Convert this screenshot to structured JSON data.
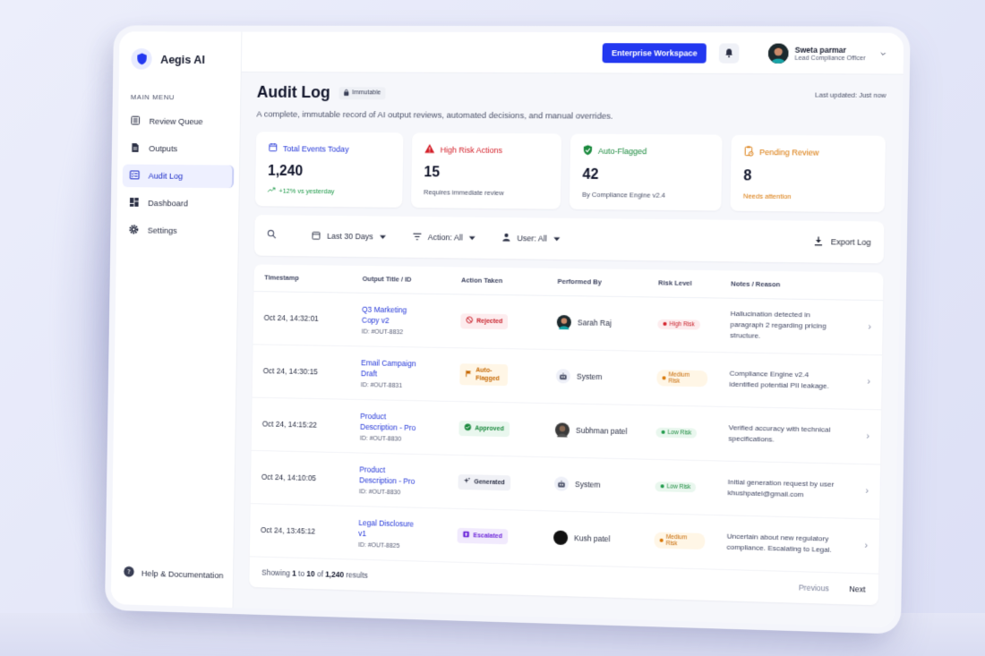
{
  "brand": {
    "name": "Aegis AI"
  },
  "sidebar": {
    "menu_title": "MAIN MENU",
    "items": [
      {
        "label": "Review Queue",
        "icon": "list-icon"
      },
      {
        "label": "Outputs",
        "icon": "document-icon"
      },
      {
        "label": "Audit Log",
        "icon": "checklist-icon",
        "active": true
      },
      {
        "label": "Dashboard",
        "icon": "grid-icon"
      },
      {
        "label": "Settings",
        "icon": "gear-icon"
      }
    ],
    "help_label": "Help & Documentation"
  },
  "topbar": {
    "workspace_button": "Enterprise Workspace",
    "user_name": "Sweta parmar",
    "user_role": "Lead Compliance Officer"
  },
  "header": {
    "title": "Audit Log",
    "badge": "Immutable",
    "last_updated": "Last updated: Just now",
    "subtitle": "A complete, immutable record of AI output reviews, automated decisions, and manual overrides."
  },
  "stats": [
    {
      "label": "Total Events Today",
      "value": "1,240",
      "sub": "+12% vs yesterday",
      "color": "#2336d8",
      "sub_color": "#1f9a4a"
    },
    {
      "label": "High Risk Actions",
      "value": "15",
      "sub": "Requires immediate review",
      "color": "#d4202a",
      "sub_color": "#4a5068"
    },
    {
      "label": "Auto-Flagged",
      "value": "42",
      "sub": "By Compliance Engine v2.4",
      "color": "#1b8a3e",
      "sub_color": "#4a5068"
    },
    {
      "label": "Pending Review",
      "value": "8",
      "sub": "Needs attention",
      "color": "#d97706",
      "sub_color": "#d97706"
    }
  ],
  "filters": {
    "date": "Last 30 Days",
    "action": "Action: All",
    "user": "User: All",
    "export": "Export Log"
  },
  "table": {
    "headers": [
      "Timestamp",
      "Output Title / ID",
      "Action Taken",
      "Performed By",
      "Risk Level",
      "Notes / Reason"
    ],
    "rows": [
      {
        "timestamp": "Oct 24, 14:32:01",
        "title": "Q3 Marketing Copy v2",
        "id": "ID: #OUT-8832",
        "action": "Rejected",
        "by": "Sarah Raj",
        "risk": "High Risk",
        "notes": "Hallucination detected in paragraph 2 regarding pricing structure."
      },
      {
        "timestamp": "Oct 24, 14:30:15",
        "title": "Email Campaign Draft",
        "id": "ID: #OUT-8831",
        "action": "Auto-Flagged",
        "by": "System",
        "risk": "Medium Risk",
        "notes": "Compliance Engine v2.4 identified potential PII leakage."
      },
      {
        "timestamp": "Oct 24, 14:15:22",
        "title": "Product Description - Pro",
        "id": "ID: #OUT-8830",
        "action": "Approved",
        "by": "Subhman patel",
        "risk": "Low Risk",
        "notes": "Verified accuracy with technical specifications."
      },
      {
        "timestamp": "Oct 24, 14:10:05",
        "title": "Product Description - Pro",
        "id": "ID: #OUT-8830",
        "action": "Generated",
        "by": "System",
        "risk": "Low Risk",
        "notes": "Initial generation request by user khushpatel@gmail.com"
      },
      {
        "timestamp": "Oct 24, 13:45:12",
        "title": "Legal Disclosure v1",
        "id": "ID: #OUT-8825",
        "action": "Escalated",
        "by": "Kush patel",
        "risk": "Medium Risk",
        "notes": "Uncertain about new regulatory compliance. Escalating to Legal."
      }
    ]
  },
  "pagination": {
    "showing": "Showing",
    "from": "1",
    "to_word": "to",
    "to": "10",
    "of_word": "of",
    "total": "1,240",
    "results": "results",
    "previous": "Previous",
    "next": "Next"
  }
}
